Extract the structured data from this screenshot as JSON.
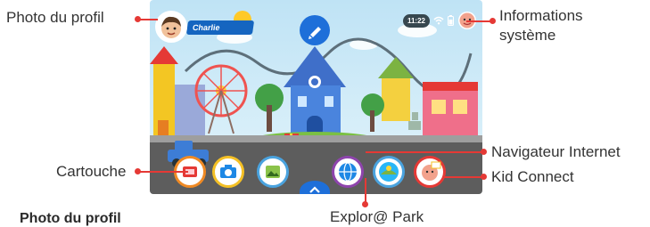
{
  "callouts": {
    "profile_photo": "Photo du profil",
    "system_info_line1": "Informations",
    "system_info_line2": "système",
    "internet_browser": "Navigateur Internet",
    "cartridge": "Cartouche",
    "kid_connect": "Kid Connect",
    "explore_park": "Explor@ Park"
  },
  "section_heading": "Photo du profil",
  "screen": {
    "profile_name": "Charlie",
    "clock": "11:22"
  },
  "colors": {
    "callout_red": "#e53935",
    "sky": "#c9e8f6",
    "accent_blue": "#1e6fd9"
  }
}
